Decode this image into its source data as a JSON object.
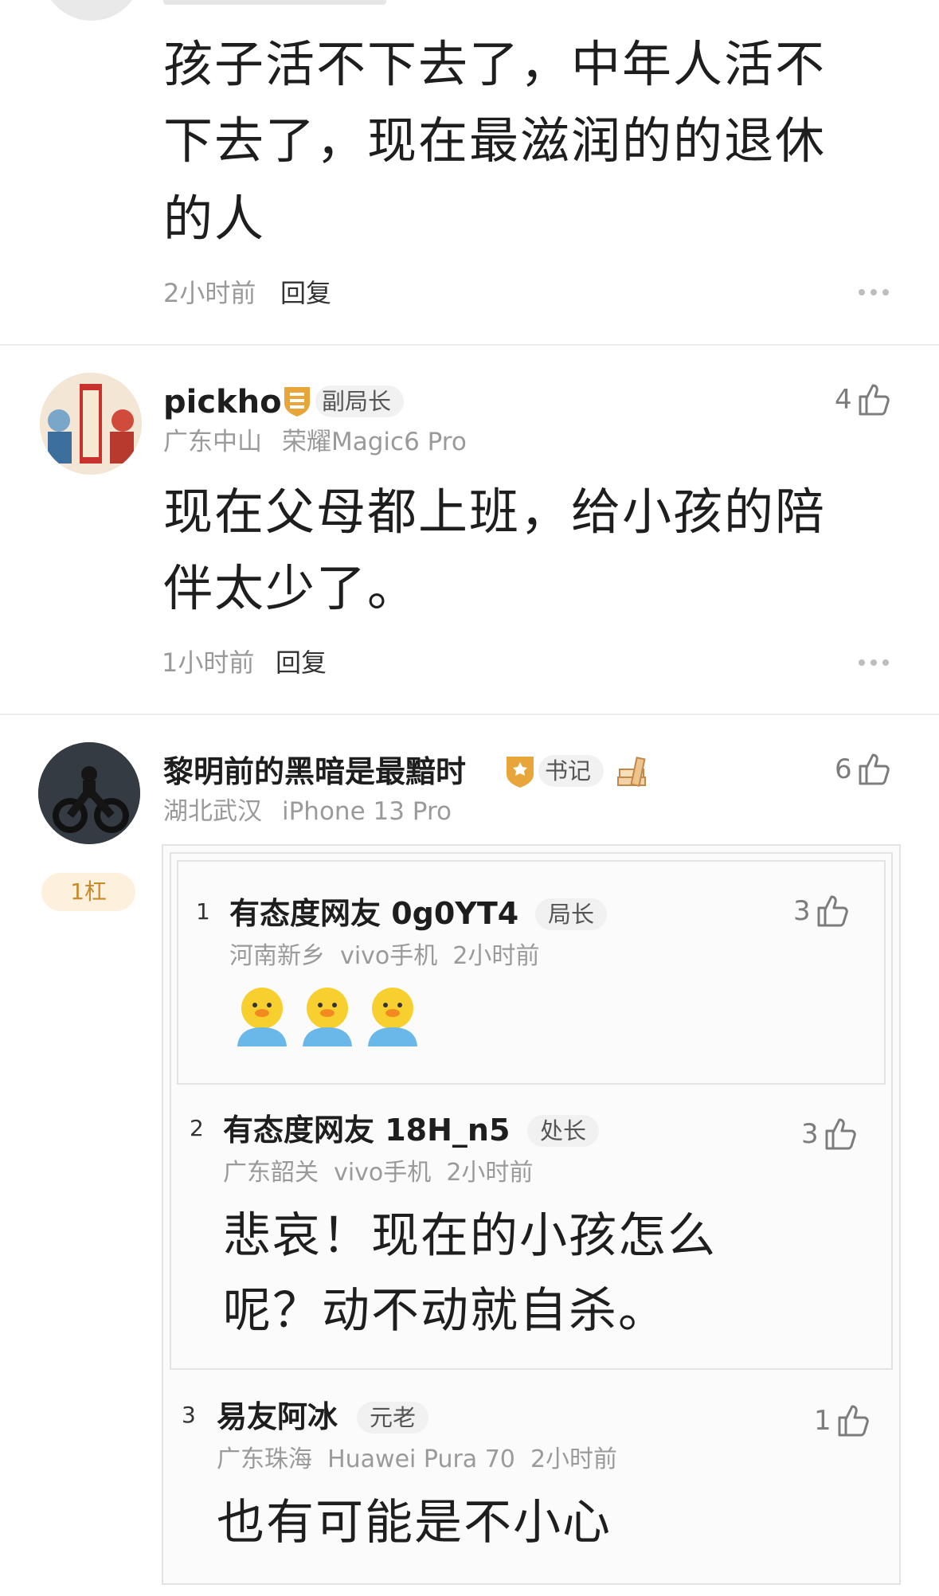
{
  "comment1": {
    "text_line1": "孩子活不下去了，中年人活不",
    "text_line2": "下去了，现在最滋润的的退休",
    "text_line3": "的人",
    "time": "2小时前",
    "reply_label": "回复"
  },
  "comment2": {
    "username": "pickho",
    "badge": "副局长",
    "location": "广东中山",
    "device": "荣耀Magic6 Pro",
    "likes": "4",
    "text_line1": "现在父母都上班，给小孩的陪",
    "text_line2": "伴太少了。",
    "time": "1小时前",
    "reply_label": "回复"
  },
  "comment3": {
    "username": "黎明前的黑暗是最黯时",
    "badge": "书记",
    "location": "湖北武汉",
    "device": "iPhone 13 Pro",
    "likes": "6",
    "floor_tag": "1杠",
    "replies": [
      {
        "index": "1",
        "username": "有态度网友 0g0YT4",
        "badge": "局长",
        "meta": "河南新乡  vivo手机  2小时前",
        "likes": "3"
      },
      {
        "index": "2",
        "username": "有态度网友 18H_n5",
        "badge": "处长",
        "meta": "广东韶关  vivo手机  2小时前",
        "likes": "3",
        "text_line1": "悲哀！现在的小孩怎么",
        "text_line2": "呢？动不动就自杀。"
      },
      {
        "index": "3",
        "username": "易友阿冰",
        "badge": "元老",
        "meta": "广东珠海  Huawei Pura 70  2小时前",
        "likes": "1",
        "text_line1": "也有可能是不小心"
      }
    ]
  },
  "icons": {
    "like": "thumbs-up-icon",
    "more": "more-dots-icon",
    "badge_gold": "shield-rank-icon",
    "badge_star": "star-rank-icon",
    "books": "books-icon",
    "duck": "duck-emoji-icon"
  },
  "colors": {
    "gold": "#e8a53a",
    "floor_tag_bg": "#fdf0dc",
    "floor_tag_text": "#c98a2c"
  }
}
